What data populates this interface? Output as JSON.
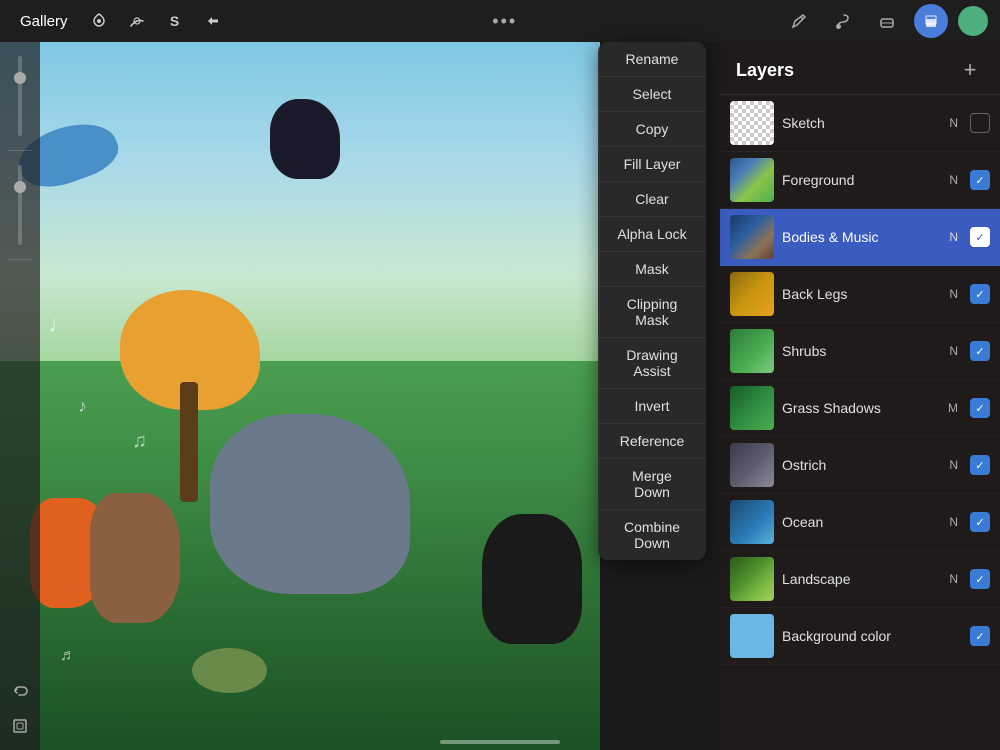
{
  "topbar": {
    "gallery_label": "Gallery",
    "tools": [
      {
        "name": "modify-tool",
        "icon": "⚙",
        "label": "Modify"
      },
      {
        "name": "brush-adjust-tool",
        "icon": "🖌",
        "label": "Brush Adjust"
      },
      {
        "name": "smudge-tool",
        "icon": "S",
        "label": "Smudge"
      },
      {
        "name": "move-tool",
        "icon": "➤",
        "label": "Move"
      }
    ],
    "three_dots": "•••",
    "right_tools": [
      {
        "name": "pencil-tool",
        "icon": "✏",
        "label": "Pencil"
      },
      {
        "name": "paint-tool",
        "icon": "🖌",
        "label": "Paint"
      },
      {
        "name": "eraser-tool",
        "icon": "◻",
        "label": "Eraser"
      },
      {
        "name": "layers-tool",
        "icon": "⧉",
        "label": "Layers",
        "active": true
      }
    ],
    "color_value": "#4caf7d"
  },
  "context_menu": {
    "items": [
      {
        "label": "Rename",
        "name": "rename-item"
      },
      {
        "label": "Select",
        "name": "select-item"
      },
      {
        "label": "Copy",
        "name": "copy-item"
      },
      {
        "label": "Fill Layer",
        "name": "fill-layer-item"
      },
      {
        "label": "Clear",
        "name": "clear-item"
      },
      {
        "label": "Alpha Lock",
        "name": "alpha-lock-item"
      },
      {
        "label": "Mask",
        "name": "mask-item"
      },
      {
        "label": "Clipping Mask",
        "name": "clipping-mask-item"
      },
      {
        "label": "Drawing Assist",
        "name": "drawing-assist-item"
      },
      {
        "label": "Invert",
        "name": "invert-item"
      },
      {
        "label": "Reference",
        "name": "reference-item"
      },
      {
        "label": "Merge Down",
        "name": "merge-down-item"
      },
      {
        "label": "Combine Down",
        "name": "combine-down-item"
      }
    ]
  },
  "layers_panel": {
    "title": "Layers",
    "add_button": "+",
    "layers": [
      {
        "name": "Sketch",
        "mode": "N",
        "checked": false,
        "active": false,
        "thumb": "sketch",
        "id": "layer-sketch"
      },
      {
        "name": "Foreground",
        "mode": "N",
        "checked": true,
        "active": false,
        "thumb": "foreground",
        "id": "layer-foreground"
      },
      {
        "name": "Bodies & Music",
        "mode": "N",
        "checked": true,
        "active": true,
        "thumb": "bodies",
        "id": "layer-bodies"
      },
      {
        "name": "Back Legs",
        "mode": "N",
        "checked": true,
        "active": false,
        "thumb": "backlegs",
        "id": "layer-backlegs"
      },
      {
        "name": "Shrubs",
        "mode": "N",
        "checked": true,
        "active": false,
        "thumb": "shrubs",
        "id": "layer-shrubs"
      },
      {
        "name": "Grass Shadows",
        "mode": "M",
        "checked": true,
        "active": false,
        "thumb": "grass",
        "id": "layer-grass"
      },
      {
        "name": "Ostrich",
        "mode": "N",
        "checked": true,
        "active": false,
        "thumb": "ostrich",
        "id": "layer-ostrich"
      },
      {
        "name": "Ocean",
        "mode": "N",
        "checked": true,
        "active": false,
        "thumb": "ocean",
        "id": "layer-ocean"
      },
      {
        "name": "Landscape",
        "mode": "N",
        "checked": true,
        "active": false,
        "thumb": "landscape",
        "id": "layer-landscape"
      },
      {
        "name": "Background color",
        "mode": "",
        "checked": true,
        "active": false,
        "thumb": "bgcol",
        "id": "layer-bgcol"
      }
    ]
  },
  "left_sidebar": {
    "icons": [
      "↩",
      "⬚",
      "⊞"
    ]
  },
  "canvas": {
    "music_notes": [
      "♩",
      "♪",
      "♫",
      "♬"
    ]
  },
  "bottom_bar": {
    "indicator": ""
  }
}
